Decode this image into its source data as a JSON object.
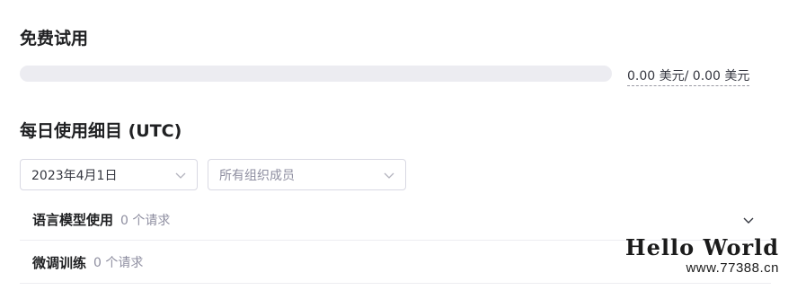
{
  "free_trial": {
    "title": "免费试用",
    "progress_fraction": 0,
    "accent_color": "#10a37f",
    "amount": "0.00 美元/ 0.00 美元"
  },
  "daily_usage": {
    "title": "每日使用细目 (UTC)",
    "date_select": {
      "value": "2023年4月1日",
      "icon": "chevron-down-icon"
    },
    "member_select": {
      "placeholder": "所有组织成员",
      "icon": "chevron-down-icon"
    },
    "rows": [
      {
        "label": "语言模型使用",
        "count": "0 个请求",
        "icon": "chevron-down-icon"
      },
      {
        "label": "微调训练",
        "count": "0 个请求"
      }
    ]
  },
  "watermark": {
    "title": "Hello World",
    "url": "www.77388.cn"
  }
}
